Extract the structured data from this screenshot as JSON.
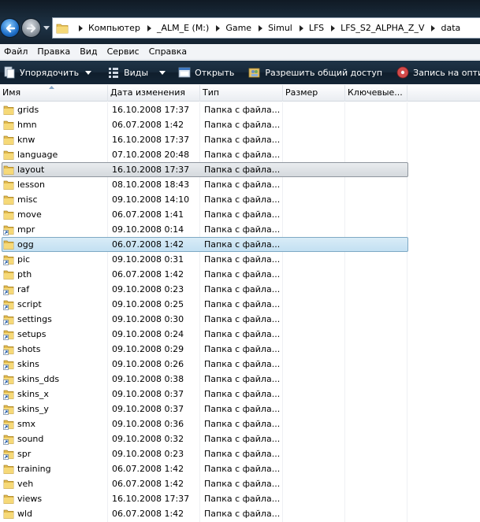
{
  "addressbar": {
    "breadcrumbs": [
      "Компьютер",
      "_ALM_E (M:)",
      "Game",
      "Simul",
      "LFS",
      "LFS_S2_ALPHA_Z_V",
      "data"
    ]
  },
  "menubar": {
    "items": [
      "Файл",
      "Правка",
      "Вид",
      "Сервис",
      "Справка"
    ]
  },
  "toolbar": {
    "organize": "Упорядочить",
    "views": "Виды",
    "open": "Открыть",
    "share": "Разрешить общий доступ",
    "burn": "Запись на оптически"
  },
  "columns": {
    "name": "Имя",
    "date": "Дата изменения",
    "type": "Тип",
    "size": "Размер",
    "keywords": "Ключевые..."
  },
  "files": [
    {
      "name": "grids",
      "date": "16.10.2008 17:37",
      "type": "Папка с файла...",
      "icon": "folder-icon"
    },
    {
      "name": "hmn",
      "date": "06.07.2008 1:42",
      "type": "Папка с файла...",
      "icon": "folder-icon"
    },
    {
      "name": "knw",
      "date": "16.10.2008 17:37",
      "type": "Папка с файла...",
      "icon": "folder-icon"
    },
    {
      "name": "language",
      "date": "07.10.2008 20:48",
      "type": "Папка с файла...",
      "icon": "folder-icon"
    },
    {
      "name": "layout",
      "date": "16.10.2008 17:37",
      "type": "Папка с файла...",
      "icon": "folder-icon",
      "state": "hover"
    },
    {
      "name": "lesson",
      "date": "08.10.2008 18:43",
      "type": "Папка с файла...",
      "icon": "folder-icon"
    },
    {
      "name": "misc",
      "date": "09.10.2008 14:10",
      "type": "Папка с файла...",
      "icon": "folder-icon"
    },
    {
      "name": "move",
      "date": "06.07.2008 1:41",
      "type": "Папка с файла...",
      "icon": "folder-icon"
    },
    {
      "name": "mpr",
      "date": "09.10.2008 0:14",
      "type": "Папка с файла...",
      "icon": "folder-shortcut-icon"
    },
    {
      "name": "ogg",
      "date": "06.07.2008 1:42",
      "type": "Папка с файла...",
      "icon": "folder-icon",
      "state": "selected"
    },
    {
      "name": "pic",
      "date": "09.10.2008 0:31",
      "type": "Папка с файла...",
      "icon": "folder-shortcut-icon"
    },
    {
      "name": "pth",
      "date": "06.07.2008 1:42",
      "type": "Папка с файла...",
      "icon": "folder-icon"
    },
    {
      "name": "raf",
      "date": "09.10.2008 0:23",
      "type": "Папка с файла...",
      "icon": "folder-shortcut-icon"
    },
    {
      "name": "script",
      "date": "09.10.2008 0:25",
      "type": "Папка с файла...",
      "icon": "folder-shortcut-icon"
    },
    {
      "name": "settings",
      "date": "09.10.2008 0:30",
      "type": "Папка с файла...",
      "icon": "folder-shortcut-icon"
    },
    {
      "name": "setups",
      "date": "09.10.2008 0:24",
      "type": "Папка с файла...",
      "icon": "folder-shortcut-icon"
    },
    {
      "name": "shots",
      "date": "09.10.2008 0:29",
      "type": "Папка с файла...",
      "icon": "folder-shortcut-icon"
    },
    {
      "name": "skins",
      "date": "09.10.2008 0:26",
      "type": "Папка с файла...",
      "icon": "folder-shortcut-icon"
    },
    {
      "name": "skins_dds",
      "date": "09.10.2008 0:38",
      "type": "Папка с файла...",
      "icon": "folder-shortcut-icon"
    },
    {
      "name": "skins_x",
      "date": "09.10.2008 0:37",
      "type": "Папка с файла...",
      "icon": "folder-shortcut-icon"
    },
    {
      "name": "skins_y",
      "date": "09.10.2008 0:37",
      "type": "Папка с файла...",
      "icon": "folder-shortcut-icon"
    },
    {
      "name": "smx",
      "date": "09.10.2008 0:36",
      "type": "Папка с файла...",
      "icon": "folder-shortcut-icon"
    },
    {
      "name": "sound",
      "date": "09.10.2008 0:32",
      "type": "Папка с файла...",
      "icon": "folder-shortcut-icon"
    },
    {
      "name": "spr",
      "date": "09.10.2008 0:23",
      "type": "Папка с файла...",
      "icon": "folder-shortcut-icon"
    },
    {
      "name": "training",
      "date": "06.07.2008 1:42",
      "type": "Папка с файла...",
      "icon": "folder-icon"
    },
    {
      "name": "veh",
      "date": "06.07.2008 1:42",
      "type": "Папка с файла...",
      "icon": "folder-icon"
    },
    {
      "name": "views",
      "date": "16.10.2008 17:37",
      "type": "Папка с файла...",
      "icon": "folder-icon"
    },
    {
      "name": "wld",
      "date": "06.07.2008 1:42",
      "type": "Папка с файла...",
      "icon": "folder-icon"
    }
  ]
}
